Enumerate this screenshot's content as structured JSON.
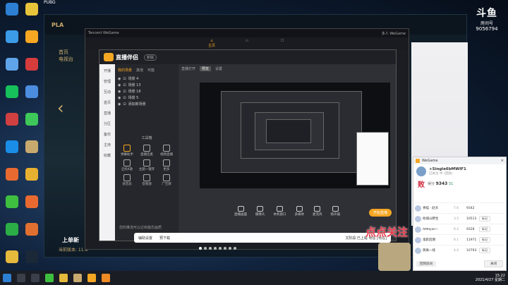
{
  "desktop": {
    "col1": [
      {
        "label": "",
        "icon": "recycle-bin-icon",
        "color": "#2d7fd3"
      },
      {
        "label": "",
        "icon": "computer-icon",
        "color": "#3b9be6"
      },
      {
        "label": "",
        "icon": "network-icon",
        "color": "#5fa4e8"
      },
      {
        "label": "",
        "icon": "iqiyi-icon",
        "color": "#16c05a"
      },
      {
        "label": "",
        "icon": "game-icon",
        "color": "#d04040"
      },
      {
        "label": "",
        "icon": "qq-icon",
        "color": "#1a8ee6"
      },
      {
        "label": "",
        "icon": "app-icon",
        "color": "#e86a30"
      },
      {
        "label": "",
        "icon": "360-icon",
        "color": "#3fbf3f"
      },
      {
        "label": "",
        "icon": "wechat-icon",
        "color": "#2aae45"
      },
      {
        "label": "",
        "icon": "folder-icon",
        "color": "#e5b93c"
      }
    ],
    "col2": [
      {
        "label": "",
        "icon": "coin-icon",
        "color": "#e8c43a"
      },
      {
        "label": "",
        "icon": "wegame-icon",
        "color": "#f5a623"
      },
      {
        "label": "",
        "icon": "wps-icon",
        "color": "#d63c3c"
      },
      {
        "label": "",
        "icon": "shield-icon",
        "color": "#4c8de0"
      },
      {
        "label": "",
        "icon": "video-icon",
        "color": "#3ec85a"
      },
      {
        "label": "",
        "icon": "league-icon",
        "color": "#c8aa6e"
      },
      {
        "label": "",
        "icon": "chrome-icon",
        "color": "#e8b030"
      },
      {
        "label": "",
        "icon": "game2-icon",
        "color": "#e86a30"
      },
      {
        "label": "",
        "icon": "game3-icon",
        "color": "#e07030"
      },
      {
        "label": "",
        "icon": "steam-icon",
        "color": "#1b2838"
      }
    ]
  },
  "pubg_label": "PUBG",
  "lol": {
    "logo": "PLA",
    "nav1": "首页",
    "nav2": "电视台",
    "promo": "上单新",
    "version": "当前版本: 11.8",
    "side": "太空\n猴子"
  },
  "wegame": {
    "title": "Tencent WeGame",
    "tab_home": "主页",
    "user": "多人 WeGame"
  },
  "app": {
    "brand": "直播伴侣",
    "version": "新版",
    "left_nav": [
      "开播",
      "管理",
      "互动",
      "首页",
      "直播",
      "分区",
      "备份",
      "主持",
      "收藏"
    ],
    "scene_tabs": [
      "我的场景",
      "其他",
      "可能"
    ],
    "scenes": [
      "场景 4",
      "场景 13",
      "场景 18",
      "场景 5",
      "添加新场景"
    ],
    "tools_title": "工具箱",
    "tools": [
      "弹幕助手",
      "直播连麦",
      "视频直播",
      "全民K歌",
      "主题一键开",
      "更多",
      "语音房",
      "音频源",
      "广告牌"
    ],
    "preview_labels": [
      "直播打开",
      "预览",
      "设置"
    ],
    "bottom_buttons": [
      "直播画面",
      "摄像头",
      "本机窗口",
      "多媒体",
      "麦克风",
      "扬声器"
    ],
    "start_label": "开始直播",
    "status": "您的推流可以达到最优画质"
  },
  "subbar": {
    "item1": "辅助设置",
    "item2": "预下载",
    "item3": "文阶段 已上载 电信 [电信]"
  },
  "huya": {
    "brand": "斗鱼",
    "sub": "房间号",
    "room_id": "9056794"
  },
  "watermark": "点点关注",
  "chat": {
    "title": "WeGame",
    "user_name": "+Single6bMWIF1",
    "user_sub": "已关注 中 (回放)",
    "result": "败",
    "score_label": "得分",
    "score_value": "9343",
    "score_extra": "31",
    "rows": [
      {
        "name": "青蛙 · 赵天",
        "k": "7.6",
        "s": "9342",
        "btn": ""
      },
      {
        "name": "他城山野生",
        "k": "3.5",
        "s": "10513",
        "btn": "标记"
      },
      {
        "name": "AMRyan~",
        "k": "6.2",
        "s": "9328",
        "btn": "标记"
      },
      {
        "name": "鬼影后期",
        "k": "6.1",
        "s": "11971",
        "btn": "标记"
      },
      {
        "name": "阴离一排",
        "k": "4.4",
        "s": "10793",
        "btn": "标记"
      }
    ],
    "footer_left": "回到房间",
    "footer_right": "关闭"
  },
  "taskbar": {
    "time": "15:22",
    "date": "2021/4/27 星期二"
  }
}
